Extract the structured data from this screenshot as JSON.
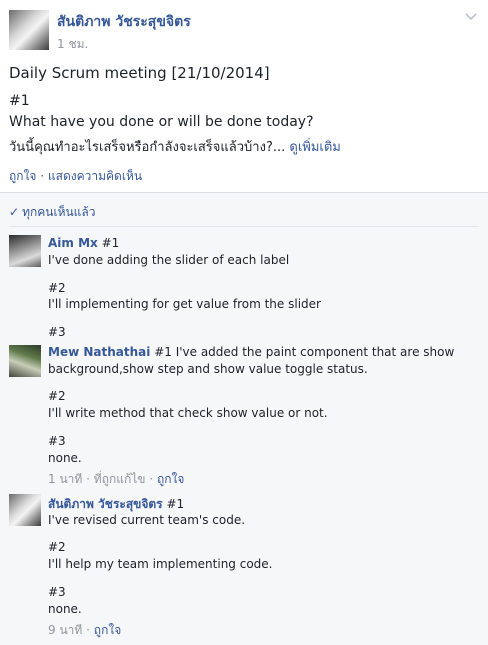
{
  "post": {
    "author": "สันติภาพ วัชระสุขจิตร",
    "time": "1 ชม.",
    "lines": [
      "Daily Scrum meeting [21/10/2014]",
      "#1",
      "What have you done or will be done today?",
      "วันนี้คุณทำอะไรเสร็จหรือกำลังจะเสร็จแล้วบ้าง?..."
    ],
    "see_more": "ดูเพิ่มเติม",
    "like": "ถูกใจ",
    "sep": "·",
    "comment": "แสดงความคิดเห็น",
    "seen_by_all": "ทุกคนเห็นแล้ว"
  },
  "comments": [
    {
      "author": "Aim Mx",
      "lines": [
        "#1",
        "I've done adding the slider of each label",
        "#2",
        "I'll implementing for get value from the slider",
        "#3"
      ]
    },
    {
      "author": "Mew Nathathai",
      "lines": [
        "#1 I've added the paint component that are show",
        "background,show step and show value toggle status.",
        "#2",
        "I'll write method that check show value or not.",
        "#3",
        "none."
      ],
      "time": "1 นาที",
      "edited": "ที่ถูกแก้ไข",
      "like": "ถูกใจ"
    },
    {
      "author": "สันติภาพ วัชระสุขจิตร",
      "lines": [
        "#1",
        "I've revised current team's code.",
        "#2",
        "I'll help my team implementing code.",
        "#3",
        "none."
      ],
      "time": "9 นาที",
      "like": "ถูกใจ"
    }
  ],
  "icons": {
    "chevron": "chevron-down-icon",
    "check": "check-icon"
  },
  "colors": {
    "link": "#365899",
    "text": "#1d2129",
    "meta": "#90949c",
    "comment_bg": "#f6f7f9"
  }
}
